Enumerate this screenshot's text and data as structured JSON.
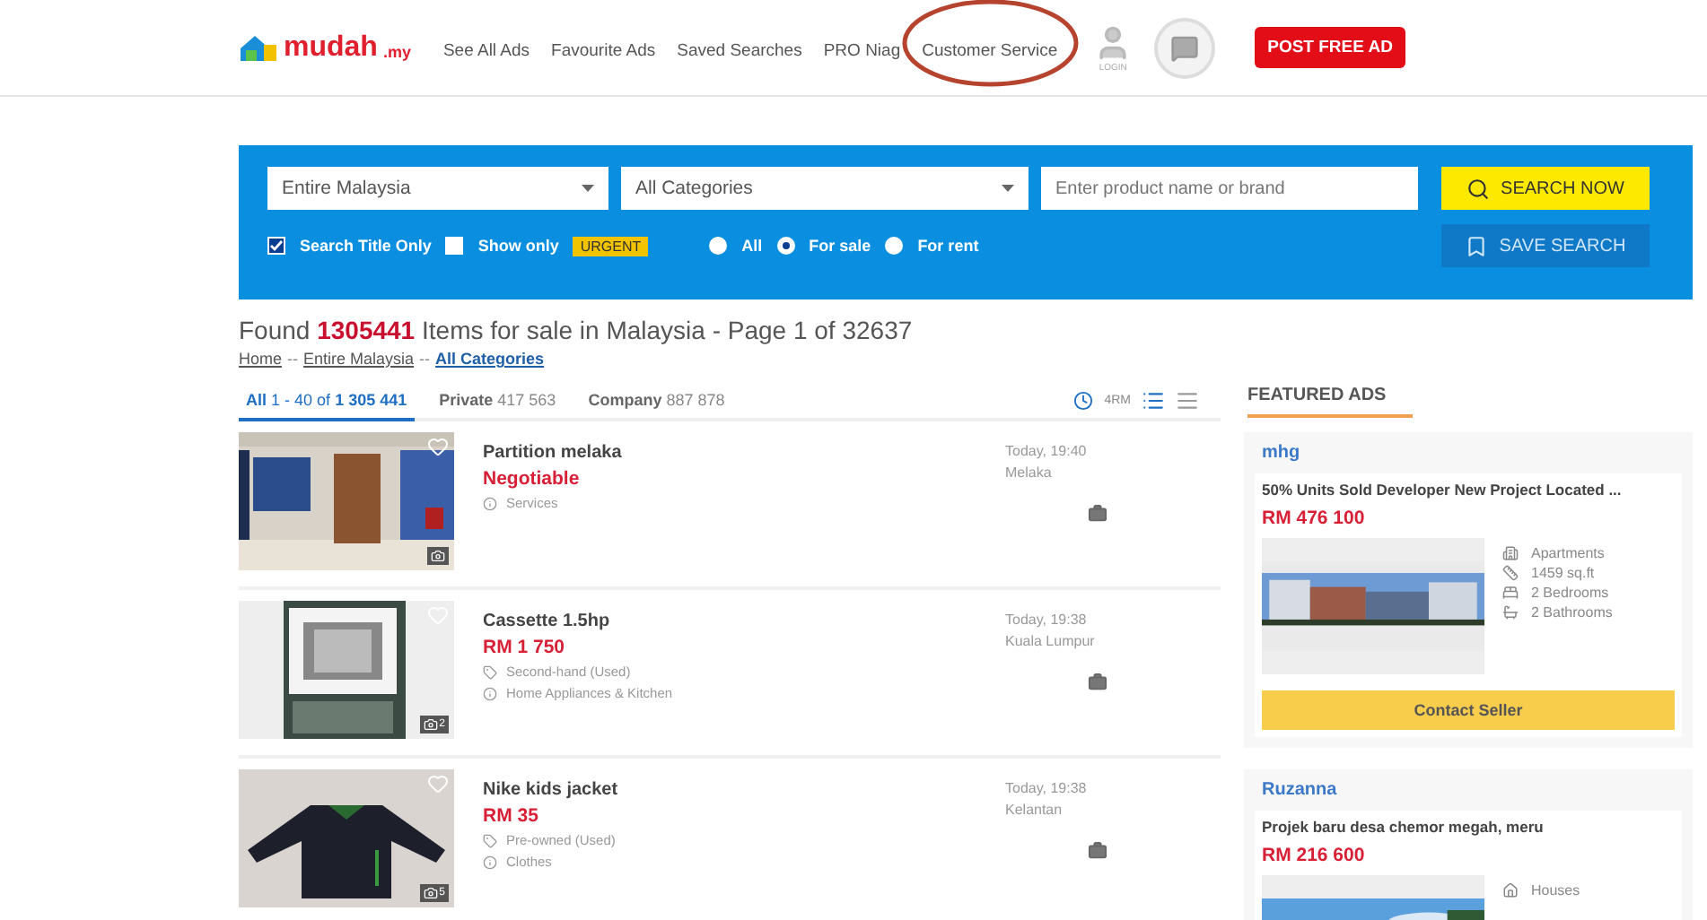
{
  "nav": {
    "logo": "mudah",
    "logo_suffix": ".my",
    "links": [
      {
        "label": "See All Ads",
        "circled": false
      },
      {
        "label": "Favourite Ads",
        "circled": false
      },
      {
        "label": "Saved Searches",
        "circled": false
      },
      {
        "label": "PRO Niag",
        "circled": false
      },
      {
        "label": "Customer Service",
        "circled": true
      }
    ],
    "login_label": "LOGIN",
    "post_button": "POST FREE AD"
  },
  "search": {
    "region": "Entire Malaysia",
    "category": "All Categories",
    "placeholder": "Enter product name or brand",
    "search_button": "SEARCH NOW",
    "save_button": "SAVE SEARCH",
    "options": [
      {
        "label": "Search Title Only",
        "checked": true
      },
      {
        "label": "Show only",
        "checked": false
      }
    ],
    "urgent_badge": "URGENT",
    "types": [
      {
        "label": "All",
        "selected": false
      },
      {
        "label": "For sale",
        "selected": true
      },
      {
        "label": "For rent",
        "selected": false
      }
    ]
  },
  "results": {
    "found": "Found",
    "count": "1305441",
    "summary": "Items for sale in Malaysia - Page 1 of 32637"
  },
  "breadcrumbs": {
    "separator": "--",
    "items": [
      {
        "label": "Home",
        "current": false
      },
      {
        "label": "Entire Malaysia",
        "current": false
      },
      {
        "label": "All Categories",
        "current": true
      }
    ]
  },
  "tabs": [
    {
      "label": "All",
      "range": "1 - 40 of",
      "count": "1 305 441",
      "selected": true
    },
    {
      "label": "Private",
      "count": "417 563",
      "selected": false
    },
    {
      "label": "Company",
      "count": "887 878",
      "selected": false
    }
  ],
  "radius": "4RM",
  "view_modes": [
    {
      "kind": "list",
      "selected": true
    },
    {
      "kind": "compact",
      "selected": false
    }
  ],
  "listings": [
    {
      "title": "Partition melaka",
      "price": "Negotiable",
      "category": "Services",
      "time": "Today, 19:40",
      "location": "Melaka"
    },
    {
      "title": "Cassette 1.5hp",
      "price": "RM 1 750",
      "condition": "Second-hand (Used)",
      "category": "Home Appliances & Kitchen",
      "time": "Today, 19:38",
      "location": "Kuala Lumpur",
      "photos": "2"
    },
    {
      "title": "Nike kids jacket",
      "price": "RM 35",
      "condition": "Pre-owned (Used)",
      "category": "Clothes",
      "time": "Today, 19:38",
      "location": "Kelantan",
      "photos": "5"
    }
  ],
  "featured": {
    "heading": "FEATURED ADS",
    "ads": [
      {
        "seller": "mhg",
        "title": "50% Units Sold Developer New Project Located ...",
        "price": "RM 476 100",
        "specs": [
          {
            "kind": "type",
            "text": "Apartments"
          },
          {
            "kind": "size",
            "text": "1459 sq.ft"
          },
          {
            "kind": "bedrooms",
            "text": "2 Bedrooms"
          },
          {
            "kind": "bathrooms",
            "text": "2 Bathrooms"
          }
        ],
        "button": "Contact Seller"
      },
      {
        "seller": "Ruzanna",
        "title": "Projek baru desa chemor megah, meru",
        "price": "RM 216 600",
        "specs": [
          {
            "kind": "house",
            "text": "Houses"
          }
        ]
      }
    ]
  }
}
